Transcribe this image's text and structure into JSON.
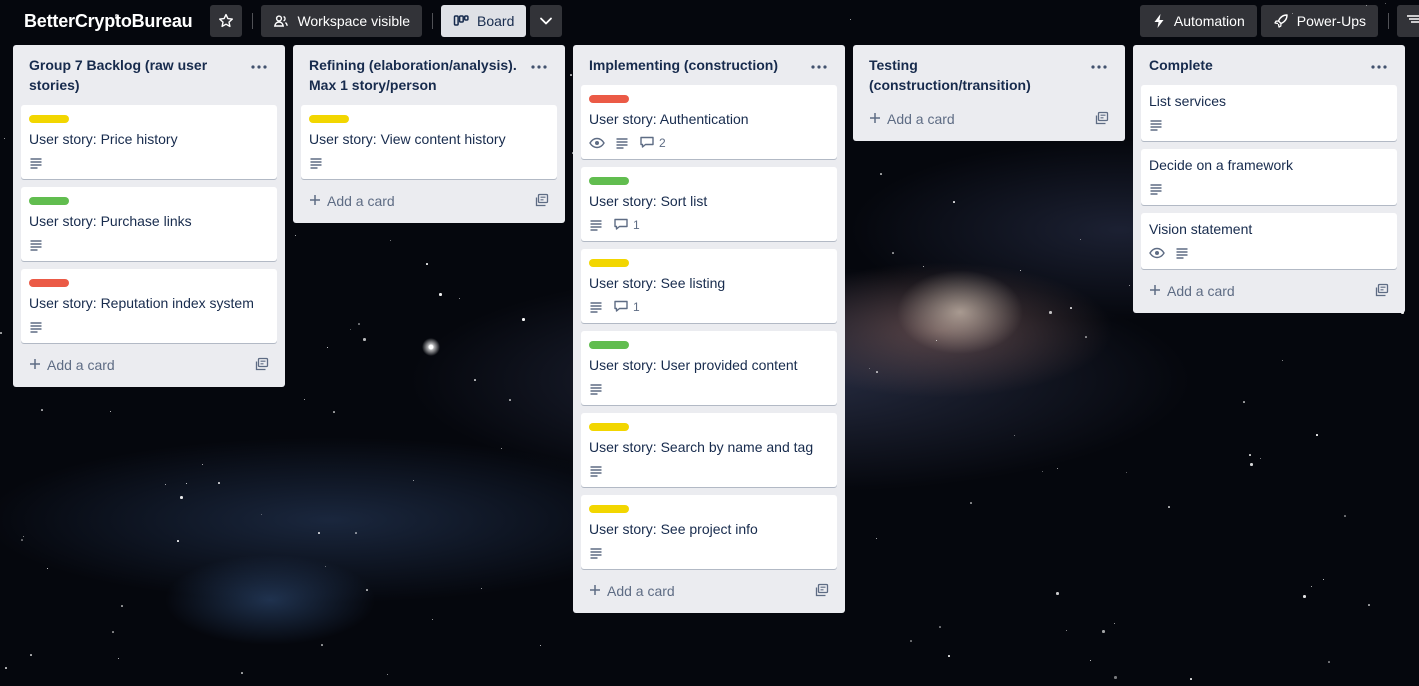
{
  "header": {
    "board_title": "BetterCryptoBureau",
    "visibility_label": "Workspace visible",
    "view_label": "Board",
    "automation_label": "Automation",
    "powerups_label": "Power-Ups"
  },
  "colors": {
    "yellow": "#f2d600",
    "green": "#61bd4f",
    "red": "#eb5a46"
  },
  "add_card_label": "Add a card",
  "lists": [
    {
      "title": "Group 7 Backlog (raw user stories)",
      "cards": [
        {
          "label": "yellow",
          "title": "User story: Price history",
          "watch": false,
          "description": true,
          "comments": ""
        },
        {
          "label": "green",
          "title": "User story: Purchase links",
          "watch": false,
          "description": true,
          "comments": ""
        },
        {
          "label": "red",
          "title": "User story: Reputation index system",
          "watch": false,
          "description": true,
          "comments": ""
        }
      ]
    },
    {
      "title": "Refining (elaboration/analysis). Max 1 story/person",
      "cards": [
        {
          "label": "yellow",
          "title": "User story: View content history",
          "watch": false,
          "description": true,
          "comments": ""
        }
      ]
    },
    {
      "title": "Implementing (construction)",
      "cards": [
        {
          "label": "red",
          "title": "User story: Authentication",
          "watch": true,
          "description": true,
          "comments": "2"
        },
        {
          "label": "green",
          "title": "User story: Sort list",
          "watch": false,
          "description": true,
          "comments": "1"
        },
        {
          "label": "yellow",
          "title": "User story: See listing",
          "watch": false,
          "description": true,
          "comments": "1"
        },
        {
          "label": "green",
          "title": "User story: User provided content",
          "watch": false,
          "description": true,
          "comments": ""
        },
        {
          "label": "yellow",
          "title": "User story: Search by name and tag",
          "watch": false,
          "description": true,
          "comments": ""
        },
        {
          "label": "yellow",
          "title": "User story: See project info",
          "watch": false,
          "description": true,
          "comments": ""
        }
      ]
    },
    {
      "title": "Testing (construction/transition)",
      "cards": []
    },
    {
      "title": "Complete",
      "cards": [
        {
          "label": "",
          "title": "List services",
          "watch": false,
          "description": true,
          "comments": ""
        },
        {
          "label": "",
          "title": "Decide on a framework",
          "watch": false,
          "description": true,
          "comments": ""
        },
        {
          "label": "",
          "title": "Vision statement",
          "watch": true,
          "description": true,
          "comments": ""
        }
      ]
    }
  ]
}
